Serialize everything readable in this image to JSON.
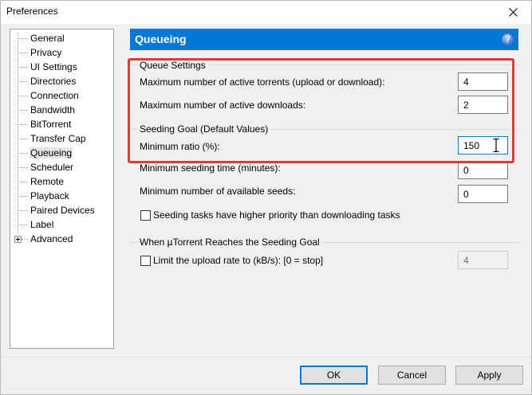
{
  "window": {
    "title": "Preferences"
  },
  "tree": {
    "items": [
      {
        "label": "General"
      },
      {
        "label": "Privacy"
      },
      {
        "label": "UI Settings"
      },
      {
        "label": "Directories"
      },
      {
        "label": "Connection"
      },
      {
        "label": "Bandwidth"
      },
      {
        "label": "BitTorrent"
      },
      {
        "label": "Transfer Cap"
      },
      {
        "label": "Queueing",
        "selected": true
      },
      {
        "label": "Scheduler"
      },
      {
        "label": "Remote"
      },
      {
        "label": "Playback"
      },
      {
        "label": "Paired Devices"
      },
      {
        "label": "Label"
      },
      {
        "label": "Advanced",
        "expandable": true
      }
    ]
  },
  "panel": {
    "title": "Queueing",
    "help_icon": "?",
    "queue_settings": {
      "group_title": "Queue Settings",
      "max_active_torrents_label": "Maximum number of active torrents (upload or download):",
      "max_active_torrents_value": "4",
      "max_active_downloads_label": "Maximum number of active downloads:",
      "max_active_downloads_value": "2"
    },
    "seeding_goal": {
      "group_title": "Seeding Goal (Default Values)",
      "min_ratio_label": "Minimum ratio (%):",
      "min_ratio_value": "150",
      "min_seeding_time_label": "Minimum seeding time (minutes):",
      "min_seeding_time_value": "0",
      "min_seeds_label": "Minimum number of available seeds:",
      "min_seeds_value": "0",
      "priority_checkbox_label": "Seeding tasks have higher priority than downloading tasks",
      "priority_checked": false
    },
    "when_reached": {
      "group_title": "When µTorrent Reaches the Seeding Goal",
      "limit_upload_label": "Limit the upload rate to (kB/s): [0 = stop]",
      "limit_upload_checked": false,
      "limit_upload_value": "4"
    }
  },
  "footer": {
    "ok_label": "OK",
    "cancel_label": "Cancel",
    "apply_label": "Apply"
  },
  "colors": {
    "accent": "#0078d7",
    "highlight": "#e03b3b"
  }
}
